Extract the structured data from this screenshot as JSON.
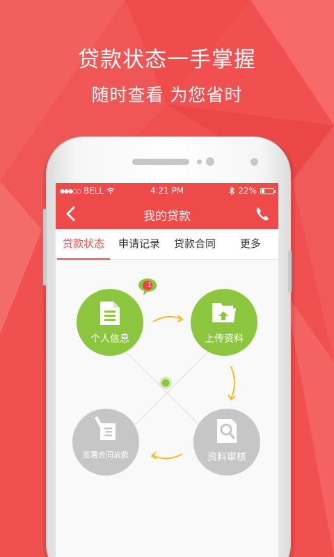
{
  "promo": {
    "headline": "贷款状态一手掌握",
    "subheadline": "随时查看 为您省时"
  },
  "status_bar": {
    "carrier": "BELL",
    "time": "4:21 PM",
    "battery": "22%",
    "battery_level": 0.22
  },
  "nav": {
    "title": "我的贷款",
    "back_icon": "chevron-left-icon",
    "phone_icon": "phone-icon"
  },
  "tabs": [
    {
      "label": "贷款状态",
      "active": true
    },
    {
      "label": "申请记录",
      "active": false
    },
    {
      "label": "贷款合同",
      "active": false
    },
    {
      "label": "更多",
      "active": false
    }
  ],
  "steps": [
    {
      "label": "个人信息",
      "state": "done",
      "icon": "document-icon"
    },
    {
      "label": "上传资料",
      "state": "done",
      "icon": "folder-upload-icon"
    },
    {
      "label": "资料审核",
      "state": "pending",
      "icon": "document-search-icon"
    },
    {
      "label": "签署合同放款",
      "state": "pending",
      "icon": "sign-contract-icon"
    }
  ],
  "notification_badge": "1",
  "colors": {
    "brand_red": "#ef4a4a",
    "step_done": "#8cc63f",
    "step_pending": "#c6c6c6",
    "arrow": "#f5b914"
  }
}
